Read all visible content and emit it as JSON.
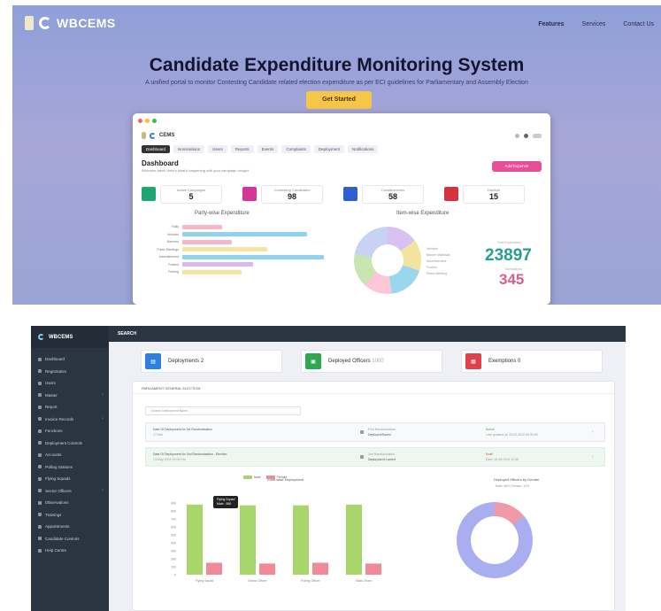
{
  "hero": {
    "brand": "WBCEMS",
    "nav": [
      "Features",
      "Services",
      "Contact Us"
    ],
    "title": "Candidate Expenditure Monitoring System",
    "subtitle": "A unified portal to monitor Contesting Candidate related election expenditure as per ECI guidelines for Parliamentary and Assembly Election",
    "cta": "Get Started"
  },
  "mockup": {
    "brand": "CEMS",
    "tabs": [
      "Dashboard",
      "Nominations",
      "Users",
      "Reports",
      "Events",
      "Complaints",
      "Deployment",
      "Notifications"
    ],
    "page_title": "Dashboard",
    "page_subtitle": "Welcome back! Here's what's happening with your campaign budget",
    "action_button": "Add Expense",
    "stats": [
      {
        "label": "Active Campaigns",
        "value": "5",
        "color": "#1ea672"
      },
      {
        "label": "Contesting Candidates",
        "value": "98",
        "color": "#d6339b"
      },
      {
        "label": "Constituencies",
        "value": "58",
        "color": "#2f5fd0"
      },
      {
        "label": "Districts",
        "value": "15",
        "color": "#d63340"
      }
    ],
    "left_chart_title": "Party-wise Expenditure",
    "right_chart_title": "Item-wise Expenditure",
    "bar_chart": {
      "categories": [
        "Rally",
        "Vehicles",
        "Banners",
        "Public Meetings",
        "Advertisement",
        "Posters",
        "Printing"
      ],
      "values": [
        0.28,
        0.88,
        0.35,
        0.6,
        1.0,
        0.5,
        0.42
      ],
      "colors": [
        "#f7b6c9",
        "#8fd3ef",
        "#f7b6c9",
        "#f4e6a0",
        "#8fd3ef",
        "#d7b8f2",
        "#f4e6a0"
      ]
    },
    "legend": [
      "Vehicles",
      "Banner Materials",
      "Advertisement",
      "Posters",
      "Public Meeting"
    ],
    "total_label": "Total Expenditure",
    "total_value": "23897",
    "count_label": "Transactions",
    "count_value": "345"
  },
  "admin": {
    "brand": "WBCEMS",
    "topbar": "SEARCH",
    "sidebar": [
      {
        "label": "Dashboard",
        "caret": false
      },
      {
        "label": "Registration",
        "caret": false
      },
      {
        "label": "Users",
        "caret": false
      },
      {
        "label": "Master",
        "caret": true
      },
      {
        "label": "Report",
        "caret": false
      },
      {
        "label": "Invoice Records",
        "caret": true
      },
      {
        "label": "Functions",
        "caret": false
      },
      {
        "label": "Deployment Controls",
        "caret": false
      },
      {
        "label": "Accounts",
        "caret": false
      },
      {
        "label": "Polling Stations",
        "caret": false
      },
      {
        "label": "Flying Squads",
        "caret": false
      },
      {
        "label": "Sector Officers",
        "caret": true
      },
      {
        "label": "Observations",
        "caret": false
      },
      {
        "label": "Trainings",
        "caret": false
      },
      {
        "label": "Appointments",
        "caret": false
      },
      {
        "label": "Candidate Controls",
        "caret": false
      },
      {
        "label": "Help Centre",
        "caret": false
      }
    ],
    "kpis": [
      {
        "label": "Deployments",
        "value": "2",
        "color": "#2f7fe0"
      },
      {
        "label": "Deployed Officers",
        "value": "1000",
        "color": "#2ea84f"
      },
      {
        "label": "Exemptions",
        "value": "0",
        "color": "#e0404a"
      }
    ],
    "panel_title": "PARLIAMENT GENERAL ELECTION",
    "search_placeholder": "Search Deployment Name",
    "rows": [
      {
        "title": "Date Of Deployment for 1st Randomization",
        "sub": "17-Mar",
        "mid_label": "First Randomization",
        "mid_value": "Deployed/Saved",
        "status": "Active",
        "status_sub": "Last updated on 23-03-2024 06:30:45",
        "status_color": "#2ea84f"
      },
      {
        "title": "Date Of Deployment for 2nd Randomization - Election",
        "sub": "13-May-2024 15:00 Hrs",
        "mid_label": "2nd Randomization",
        "mid_value": "Deployment Locked",
        "status": "Draft",
        "status_sub": "Date: 05-08-2024 11:38",
        "status_color": "#e0404a"
      }
    ],
    "bar_chart_title": "Zone-wise Deployment",
    "donut_title": "Deployed Officers by Gender",
    "donut_subtitle": "Male: 86% Female: 14%",
    "chart_data": {
      "type": "bar",
      "categories": [
        "Flying Squad",
        "Sector Officer",
        "Polling Officer",
        "Static Team"
      ],
      "series": [
        {
          "name": "Male",
          "values": [
            880,
            870,
            870,
            880
          ],
          "color": "#a9d66b"
        },
        {
          "name": "Female",
          "values": [
            150,
            140,
            150,
            140
          ],
          "color": "#f08a99"
        }
      ],
      "ylim": [
        0,
        1000
      ],
      "yticks": [
        0,
        100,
        200,
        300,
        400,
        500,
        600,
        700,
        800,
        900
      ]
    },
    "tooltip": {
      "title": "Flying Squad",
      "line": "Male : 880"
    },
    "donut_data": {
      "type": "pie",
      "labels": [
        "Male",
        "Female"
      ],
      "values": [
        86,
        14
      ]
    }
  }
}
